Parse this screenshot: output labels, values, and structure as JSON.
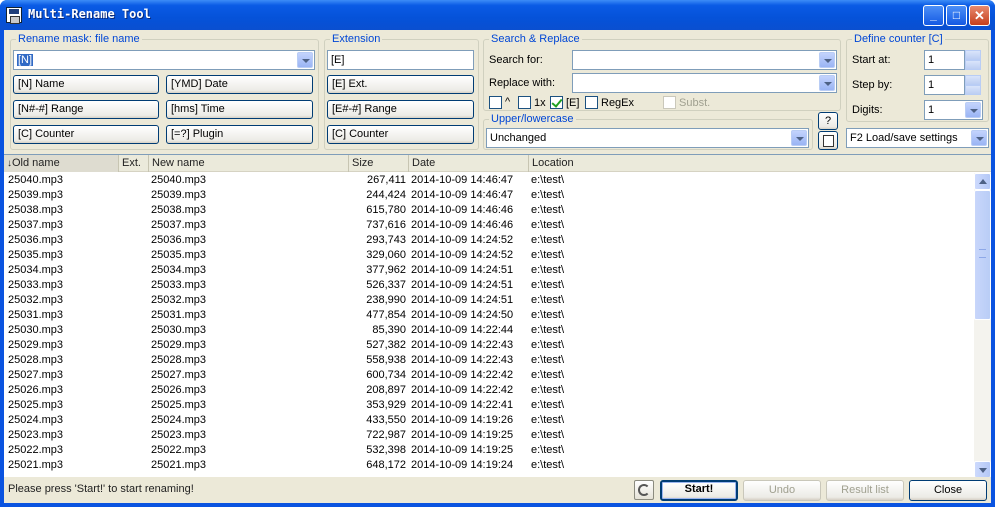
{
  "window": {
    "title": "Multi-Rename Tool"
  },
  "mask_group": {
    "legend": "Rename mask: file name",
    "value": "[N]",
    "buttons": {
      "name": "[N]  Name",
      "date": "[YMD]  Date",
      "range": "[N#-#]  Range",
      "time": "[hms]  Time",
      "counter": "[C]  Counter",
      "plugin": "[=?]  Plugin"
    }
  },
  "extension_group": {
    "legend": "Extension",
    "value": "[E]",
    "buttons": {
      "ext": "[E]  Ext.",
      "range": "[E#-#]  Range",
      "counter": "[C]  Counter"
    }
  },
  "search_group": {
    "legend": "Search & Replace",
    "search_label": "Search for:",
    "replace_label": "Replace with:",
    "search_value": "",
    "replace_value": "",
    "options": {
      "caret": "^",
      "one_x": "1x",
      "e": "[E]",
      "regex": "RegEx",
      "subst": "Subst."
    }
  },
  "case_group": {
    "legend": "Upper/lowercase",
    "value": "Unchanged",
    "help_button": "?"
  },
  "counter_group": {
    "legend": "Define counter [C]",
    "start_label": "Start at:",
    "start_value": "1",
    "step_label": "Step by:",
    "step_value": "1",
    "digits_label": "Digits:",
    "digits_value": "1",
    "load_settings": "F2 Load/save settings"
  },
  "file_list": {
    "columns": {
      "old_name": "Old name",
      "ext": "Ext.",
      "new_name": "New name",
      "size": "Size",
      "date": "Date",
      "location": "Location"
    },
    "rows": [
      {
        "old": "25040.mp3",
        "ext": "",
        "new": "25040.mp3",
        "size": "267,411",
        "date": "2014-10-09 14:46:47",
        "loc": "e:\\test\\"
      },
      {
        "old": "25039.mp3",
        "ext": "",
        "new": "25039.mp3",
        "size": "244,424",
        "date": "2014-10-09 14:46:47",
        "loc": "e:\\test\\"
      },
      {
        "old": "25038.mp3",
        "ext": "",
        "new": "25038.mp3",
        "size": "615,780",
        "date": "2014-10-09 14:46:46",
        "loc": "e:\\test\\"
      },
      {
        "old": "25037.mp3",
        "ext": "",
        "new": "25037.mp3",
        "size": "737,616",
        "date": "2014-10-09 14:46:46",
        "loc": "e:\\test\\"
      },
      {
        "old": "25036.mp3",
        "ext": "",
        "new": "25036.mp3",
        "size": "293,743",
        "date": "2014-10-09 14:24:52",
        "loc": "e:\\test\\"
      },
      {
        "old": "25035.mp3",
        "ext": "",
        "new": "25035.mp3",
        "size": "329,060",
        "date": "2014-10-09 14:24:52",
        "loc": "e:\\test\\"
      },
      {
        "old": "25034.mp3",
        "ext": "",
        "new": "25034.mp3",
        "size": "377,962",
        "date": "2014-10-09 14:24:51",
        "loc": "e:\\test\\"
      },
      {
        "old": "25033.mp3",
        "ext": "",
        "new": "25033.mp3",
        "size": "526,337",
        "date": "2014-10-09 14:24:51",
        "loc": "e:\\test\\"
      },
      {
        "old": "25032.mp3",
        "ext": "",
        "new": "25032.mp3",
        "size": "238,990",
        "date": "2014-10-09 14:24:51",
        "loc": "e:\\test\\"
      },
      {
        "old": "25031.mp3",
        "ext": "",
        "new": "25031.mp3",
        "size": "477,854",
        "date": "2014-10-09 14:24:50",
        "loc": "e:\\test\\"
      },
      {
        "old": "25030.mp3",
        "ext": "",
        "new": "25030.mp3",
        "size": "85,390",
        "date": "2014-10-09 14:22:44",
        "loc": "e:\\test\\"
      },
      {
        "old": "25029.mp3",
        "ext": "",
        "new": "25029.mp3",
        "size": "527,382",
        "date": "2014-10-09 14:22:43",
        "loc": "e:\\test\\"
      },
      {
        "old": "25028.mp3",
        "ext": "",
        "new": "25028.mp3",
        "size": "558,938",
        "date": "2014-10-09 14:22:43",
        "loc": "e:\\test\\"
      },
      {
        "old": "25027.mp3",
        "ext": "",
        "new": "25027.mp3",
        "size": "600,734",
        "date": "2014-10-09 14:22:42",
        "loc": "e:\\test\\"
      },
      {
        "old": "25026.mp3",
        "ext": "",
        "new": "25026.mp3",
        "size": "208,897",
        "date": "2014-10-09 14:22:42",
        "loc": "e:\\test\\"
      },
      {
        "old": "25025.mp3",
        "ext": "",
        "new": "25025.mp3",
        "size": "353,929",
        "date": "2014-10-09 14:22:41",
        "loc": "e:\\test\\"
      },
      {
        "old": "25024.mp3",
        "ext": "",
        "new": "25024.mp3",
        "size": "433,550",
        "date": "2014-10-09 14:19:26",
        "loc": "e:\\test\\"
      },
      {
        "old": "25023.mp3",
        "ext": "",
        "new": "25023.mp3",
        "size": "722,987",
        "date": "2014-10-09 14:19:25",
        "loc": "e:\\test\\"
      },
      {
        "old": "25022.mp3",
        "ext": "",
        "new": "25022.mp3",
        "size": "532,398",
        "date": "2014-10-09 14:19:25",
        "loc": "e:\\test\\"
      },
      {
        "old": "25021.mp3",
        "ext": "",
        "new": "25021.mp3",
        "size": "648,172",
        "date": "2014-10-09 14:19:24",
        "loc": "e:\\test\\"
      }
    ]
  },
  "status": {
    "message": "Please press 'Start!' to start renaming!",
    "start": "Start!",
    "undo": "Undo",
    "result_list": "Result list",
    "close": "Close"
  }
}
